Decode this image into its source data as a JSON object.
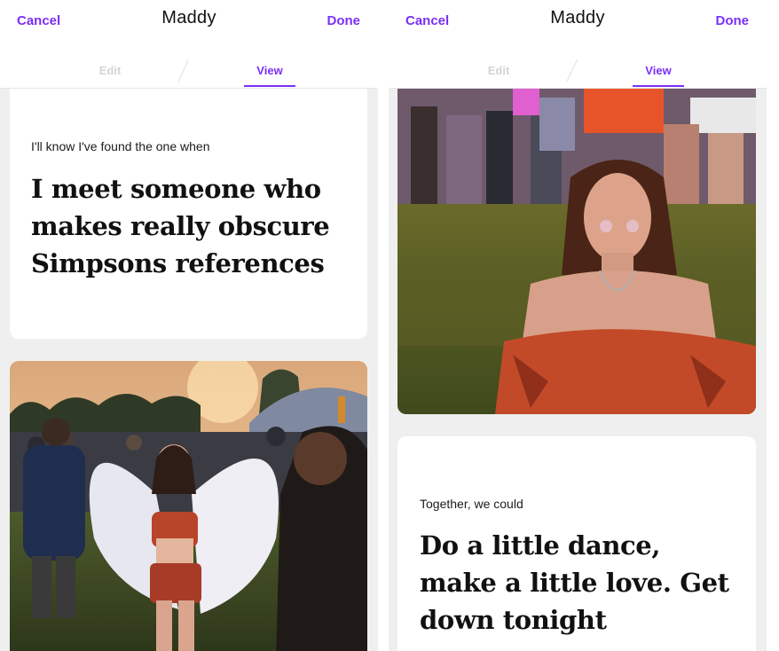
{
  "left_screen": {
    "header": {
      "cancel": "Cancel",
      "title": "Maddy",
      "done": "Done"
    },
    "tabs": {
      "edit": "Edit",
      "view": "View",
      "active": "View"
    },
    "prompt": {
      "question": "I'll know I've found the one when",
      "answer": "I meet someone who makes really obscure Simpsons references"
    },
    "photo": {
      "description_icon": "photo-festival-angel-wings"
    }
  },
  "right_screen": {
    "header": {
      "cancel": "Cancel",
      "title": "Maddy",
      "done": "Done"
    },
    "tabs": {
      "edit": "Edit",
      "view": "View",
      "active": "View"
    },
    "photo": {
      "description_icon": "photo-festival-portrait"
    },
    "prompt": {
      "question": "Together, we could",
      "answer": "Do a little dance, make a little love. Get down tonight"
    }
  },
  "colors": {
    "accent": "#7b2ff7",
    "background": "#efefef",
    "card": "#ffffff",
    "text": "#111111"
  }
}
